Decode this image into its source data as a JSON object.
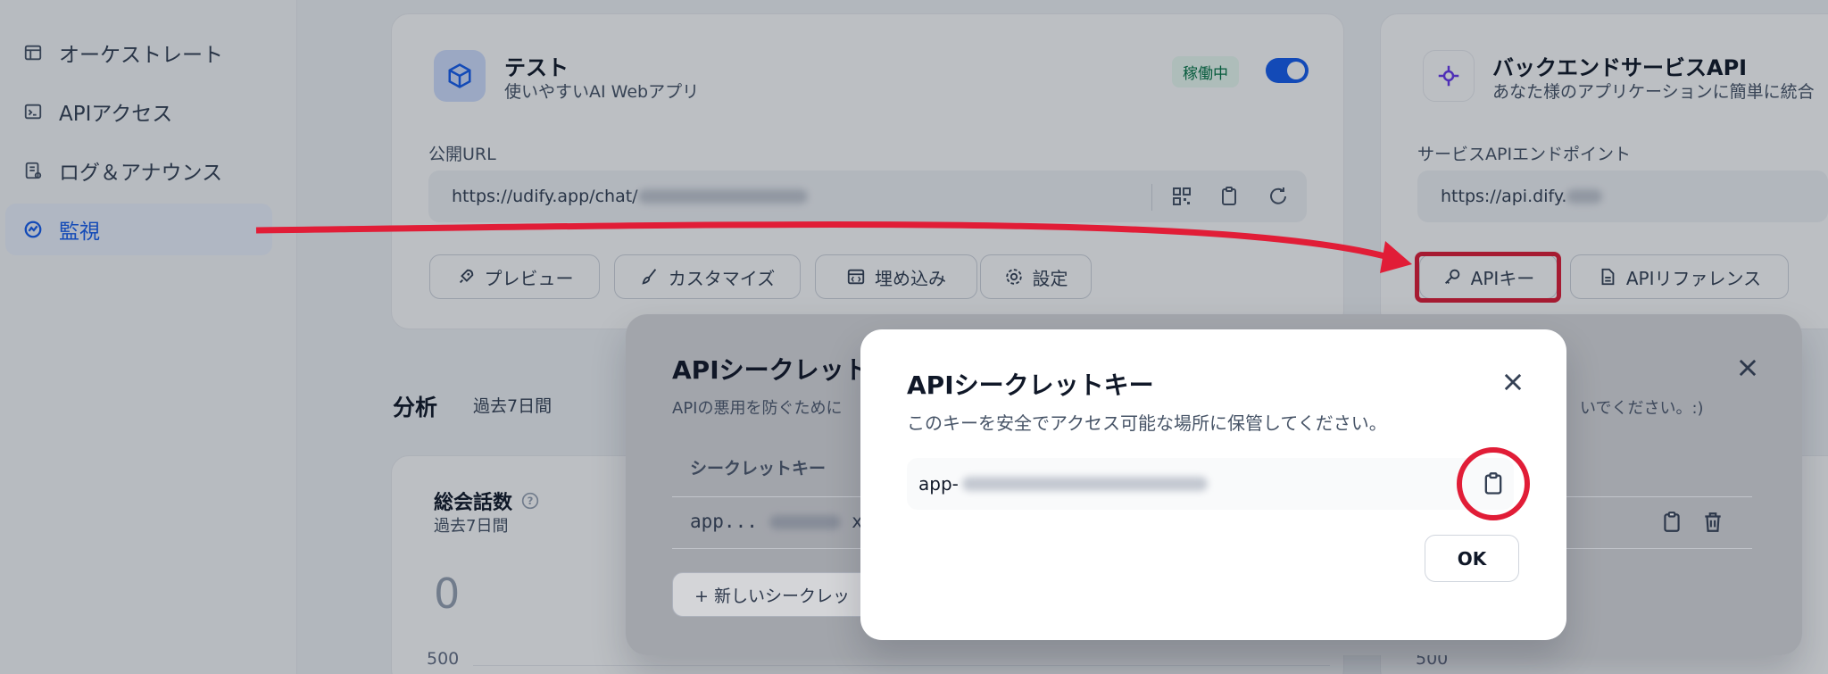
{
  "sidebar": {
    "items": [
      {
        "label": "オーケストレート",
        "icon": "orchestrate-icon"
      },
      {
        "label": "APIアクセス",
        "icon": "terminal-icon"
      },
      {
        "label": "ログ＆アナウンス",
        "icon": "log-icon"
      },
      {
        "label": "監視",
        "icon": "monitor-icon",
        "active": true
      }
    ]
  },
  "webapp": {
    "title": "テスト",
    "subtitle": "使いやすいAI Webアプリ",
    "status": "稼働中",
    "url_label": "公開URL",
    "url_visible": "https://udify.app/chat/",
    "buttons": {
      "preview": "プレビュー",
      "customize": "カスタマイズ",
      "embed": "埋め込み",
      "settings": "設定"
    }
  },
  "backend": {
    "title": "バックエンドサービスAPI",
    "subtitle": "あなた様のアプリケーションに簡単に統合",
    "endpoint_label": "サービスAPIエンドポイント",
    "endpoint_visible": "https://api.dify.",
    "api_key_button": "APIキー",
    "api_reference_button": "APIリファレンス"
  },
  "analysis": {
    "label": "分析",
    "period": "過去7日間",
    "total_title": "総会話数",
    "total_sub": "過去7日間",
    "total_value": "0",
    "axis_tick": "500",
    "axis_tick_right": "500"
  },
  "secret_list_modal": {
    "title": "APIシークレット",
    "subtitle": "APIの悪用を防ぐために",
    "subtitle_tail": "いでください。:)",
    "col_header": "シークレットキー",
    "row_key": "app...",
    "row_key_tail": "x",
    "new_button": "+ 新しいシークレッ"
  },
  "secret_modal": {
    "title": "APIシークレットキー",
    "subtitle": "このキーを安全でアクセス可能な場所に保管してください。",
    "key_prefix": "app-",
    "ok_label": "OK"
  },
  "colors": {
    "accent": "#155eef",
    "highlight": "#e11d37"
  }
}
